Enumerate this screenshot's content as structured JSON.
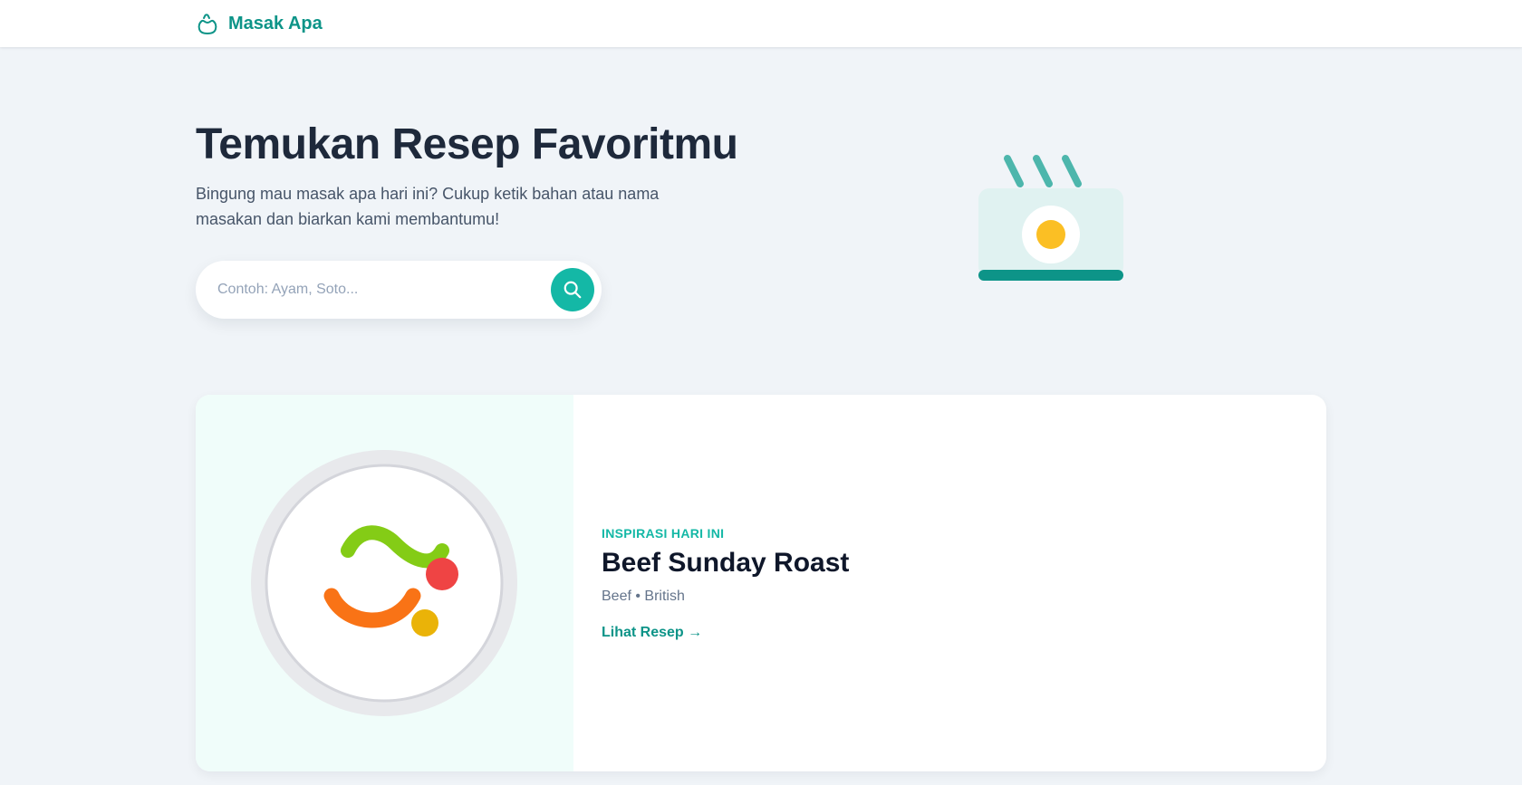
{
  "header": {
    "brand_name": "Masak Apa",
    "brand_icon": "cooking-pot-icon"
  },
  "hero": {
    "title": "Temukan Resep Favoritmu",
    "subtitle": "Bingung mau masak apa hari ini? Cukup ketik bahan atau nama masakan dan biarkan kami membantumu!",
    "search": {
      "placeholder": "Contoh: Ayam, Soto...",
      "value": "",
      "button_icon": "search-icon"
    },
    "illustration": "steaming-egg-dish-icon"
  },
  "featured": {
    "eyebrow": "INSPIRASI HARI INI",
    "title": "Beef Sunday Roast",
    "meta": "Beef • British",
    "link_label": "Lihat Resep →",
    "image_icon": "food-plate-icon"
  },
  "colors": {
    "brand": "#0d9488",
    "accent": "#14b8a6",
    "page_background": "#f0f4f8",
    "heading": "#1e293b",
    "card_image_background": "#f0fdfa",
    "egg_yolk": "#fbbf24",
    "food_green": "#84cc16",
    "food_orange": "#f97316",
    "food_red": "#ef4444",
    "food_yellow": "#eab308"
  }
}
